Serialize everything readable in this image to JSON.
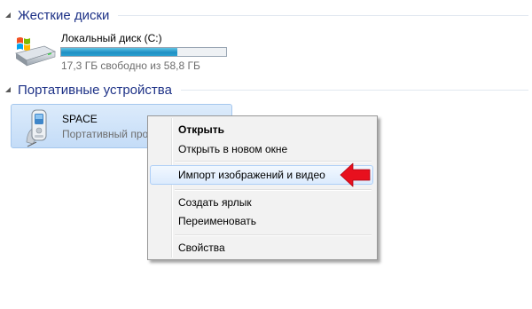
{
  "groups": {
    "hard_disks": {
      "title": "Жесткие диски"
    },
    "portable": {
      "title": "Портативные устройства"
    }
  },
  "local_disk": {
    "name": "Локальный диск (C:)",
    "free_text": "17,3 ГБ свободно из 58,8 ГБ",
    "used_fraction": 0.706,
    "icon": "windows-drive-icon"
  },
  "device": {
    "name": "SPACE",
    "type": "Портативный про",
    "icon": "mobile-phone-icon"
  },
  "context_menu": {
    "open": "Открыть",
    "open_new_window": "Открыть в новом окне",
    "import": "Импорт изображений и видео",
    "create_shortcut": "Создать ярлык",
    "rename": "Переименовать",
    "properties": "Свойства"
  },
  "colors": {
    "header_text": "#1e3287",
    "bar_fill": "#1f8fc4",
    "arrow": "#e8101e",
    "selection": "#c4dcf7"
  }
}
